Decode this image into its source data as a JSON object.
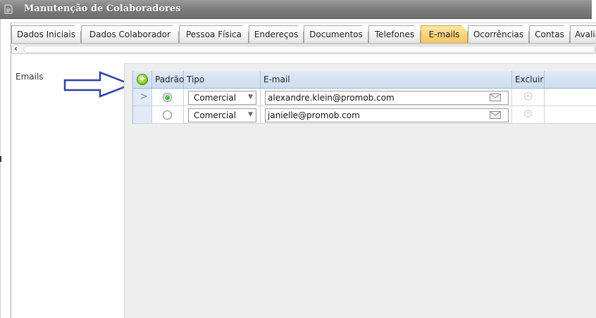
{
  "window": {
    "title": "Manutenção de Colaboradores"
  },
  "tabs": [
    {
      "label": "Dados Iniciais",
      "active": false
    },
    {
      "label": "Dados Colaborador",
      "active": false
    },
    {
      "label": "Pessoa Física",
      "active": false
    },
    {
      "label": "Endereços",
      "active": false
    },
    {
      "label": "Documentos",
      "active": false
    },
    {
      "label": "Telefones",
      "active": false
    },
    {
      "label": "E-mails",
      "active": true
    },
    {
      "label": "Ocorrências",
      "active": false
    },
    {
      "label": "Contas",
      "active": false
    },
    {
      "label": "Avaliaç",
      "active": false
    }
  ],
  "scroll": {
    "left_arrow": "‹"
  },
  "section": {
    "label": "Emails"
  },
  "grid": {
    "headers": {
      "padrao": "Padrão",
      "tipo": "Tipo",
      "email": "E-mail",
      "excluir": "Excluir"
    },
    "add_icon": "plus-circle-icon",
    "rows": [
      {
        "current": true,
        "pointer": ">",
        "padrao": true,
        "tipo": "Comercial",
        "email": "alexandre.klein@promob.com"
      },
      {
        "current": false,
        "pointer": "",
        "padrao": false,
        "tipo": "Comercial",
        "email": "janielle@promob.com"
      }
    ]
  },
  "colors": {
    "active_tab": "#f8d27a",
    "header_bg": "#cddcef",
    "arrow": "#2b3fa8",
    "add_button": "#8fce2a"
  }
}
